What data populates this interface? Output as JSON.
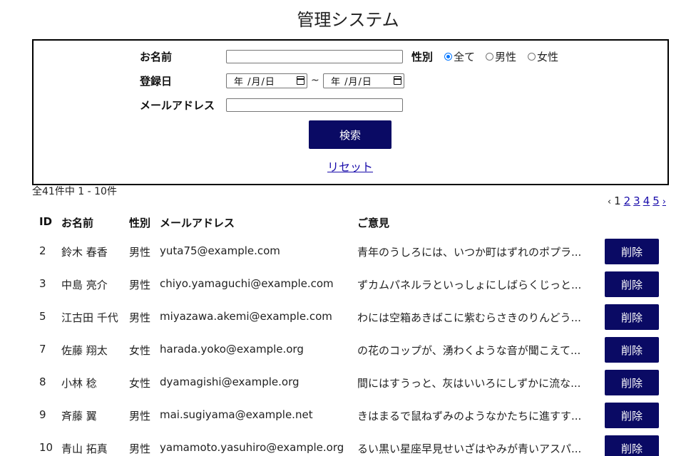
{
  "title": "管理システム",
  "search": {
    "name_label": "お名前",
    "gender_label": "性別",
    "gender_options": [
      "全て",
      "男性",
      "女性"
    ],
    "gender_selected": "全て",
    "date_label": "登録日",
    "date_placeholder": "年 /月/日",
    "date_separator": "~",
    "email_label": "メールアドレス",
    "search_button": "検索",
    "reset_link": "リセット"
  },
  "results": {
    "count_text": "全41件中 1 - 10件",
    "pagination": {
      "prev": "‹",
      "current": "1",
      "pages": [
        "2",
        "3",
        "4",
        "5"
      ],
      "next": "›"
    },
    "headers": {
      "id": "ID",
      "name": "お名前",
      "gender": "性別",
      "email": "メールアドレス",
      "opinion": "ご意見"
    },
    "delete_label": "削除",
    "rows": [
      {
        "id": "2",
        "name": "鈴木 春香",
        "gender": "男性",
        "email": "yuta75@example.com",
        "opinion": "青年のうしろには、いつか町はずれのポプラ..."
      },
      {
        "id": "3",
        "name": "中島 亮介",
        "gender": "男性",
        "email": "chiyo.yamaguchi@example.com",
        "opinion": "ずカムパネルラといっしょにしばらくじっと..."
      },
      {
        "id": "5",
        "name": "江古田 千代",
        "gender": "男性",
        "email": "miyazawa.akemi@example.com",
        "opinion": "わには空箱あきばこに紫むらさきのりんどう..."
      },
      {
        "id": "7",
        "name": "佐藤 翔太",
        "gender": "女性",
        "email": "harada.yoko@example.org",
        "opinion": "の花のコップが、湧わくような音が聞こえて..."
      },
      {
        "id": "8",
        "name": "小林 稔",
        "gender": "女性",
        "email": "dyamagishi@example.org",
        "opinion": "間にはすうっと、灰はいいろにしずかに流な..."
      },
      {
        "id": "9",
        "name": "斉藤 翼",
        "gender": "男性",
        "email": "mai.sugiyama@example.net",
        "opinion": "きはまるで鼠ねずみのようなかたちに進すす..."
      },
      {
        "id": "10",
        "name": "青山 拓真",
        "gender": "男性",
        "email": "yamamoto.yasuhiro@example.org",
        "opinion": "るい黒い星座早見せいざはやみが青いアスパ..."
      }
    ]
  }
}
